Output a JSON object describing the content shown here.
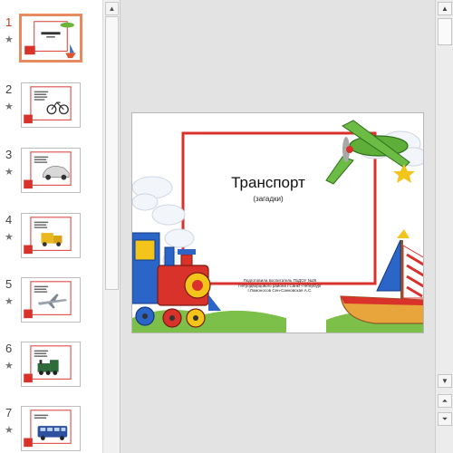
{
  "thumbnails": [
    {
      "number": "1",
      "star": "★",
      "selected": true
    },
    {
      "number": "2",
      "star": "★"
    },
    {
      "number": "3",
      "star": "★"
    },
    {
      "number": "4",
      "star": "★"
    },
    {
      "number": "5",
      "star": "★"
    },
    {
      "number": "6",
      "star": "★"
    },
    {
      "number": "7",
      "star": "★"
    }
  ],
  "slide": {
    "title": "Транспорт",
    "subtitle": "(загадки)",
    "credits": [
      "Подготовила воспитатель ГБДОУ №26",
      "Петродворцового района г.Санкт-Петербург",
      "г.Ломоносов Сен-Санковская А.С."
    ]
  },
  "scrollbar": {
    "up": "▲",
    "down": "▼",
    "prev_slide": "⏶",
    "next_slide": "⏷"
  },
  "colors": {
    "selected_thumb_border": "#e88a60",
    "frame_red": "#d9312b",
    "train_red": "#d8322a",
    "train_blue": "#2c65c8",
    "plane_green": "#4a9b2e"
  }
}
